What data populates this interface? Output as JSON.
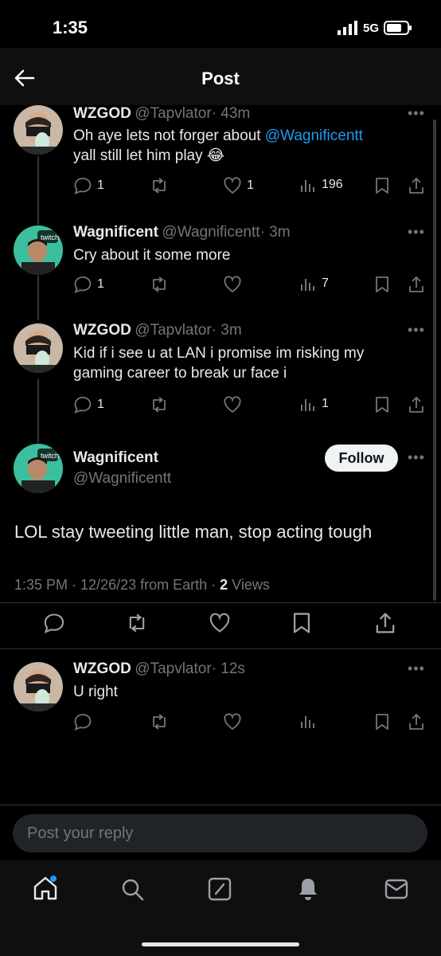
{
  "status_bar": {
    "time": "1:35",
    "network": "5G"
  },
  "header": {
    "title": "Post"
  },
  "thread": [
    {
      "name": "WZGOD",
      "handle": "@Tapvlator",
      "time": "· 43m",
      "text_before": "Oh aye lets not forger about ",
      "mention": "@Wagnificentt",
      "text_after": "yall still let him play 😂",
      "replies": "1",
      "reposts": "",
      "likes": "1",
      "views": "196"
    },
    {
      "name": "Wagnificent",
      "handle": "@Wagnificentt",
      "time": "· 3m",
      "text": "Cry about it some more",
      "replies": "1",
      "reposts": "",
      "likes": "",
      "views": "7"
    },
    {
      "name": "WZGOD",
      "handle": "@Tapvlator",
      "time": "· 3m",
      "text_line1": "Kid if i see u at LAN i promise im risking my",
      "text_line2": "gaming career to break ur face i",
      "replies": "1",
      "reposts": "",
      "likes": "",
      "views": "1"
    }
  ],
  "main_post": {
    "name": "Wagnificent",
    "handle": "@Wagnificentt",
    "follow_label": "Follow",
    "text": "LOL stay  tweeting little man, stop acting tough",
    "meta": "1:35 PM · 12/26/23 from Earth · ",
    "views_count": "2",
    "views_label": " Views"
  },
  "reply": {
    "name": "WZGOD",
    "handle": "@Tapvlator",
    "time": "· 12s",
    "text": "U right"
  },
  "composer": {
    "placeholder": "Post your reply"
  },
  "avatar_badge_text": "twitch",
  "colors": {
    "accent": "#1d9bf0",
    "muted": "#71767b",
    "background": "#000000"
  }
}
